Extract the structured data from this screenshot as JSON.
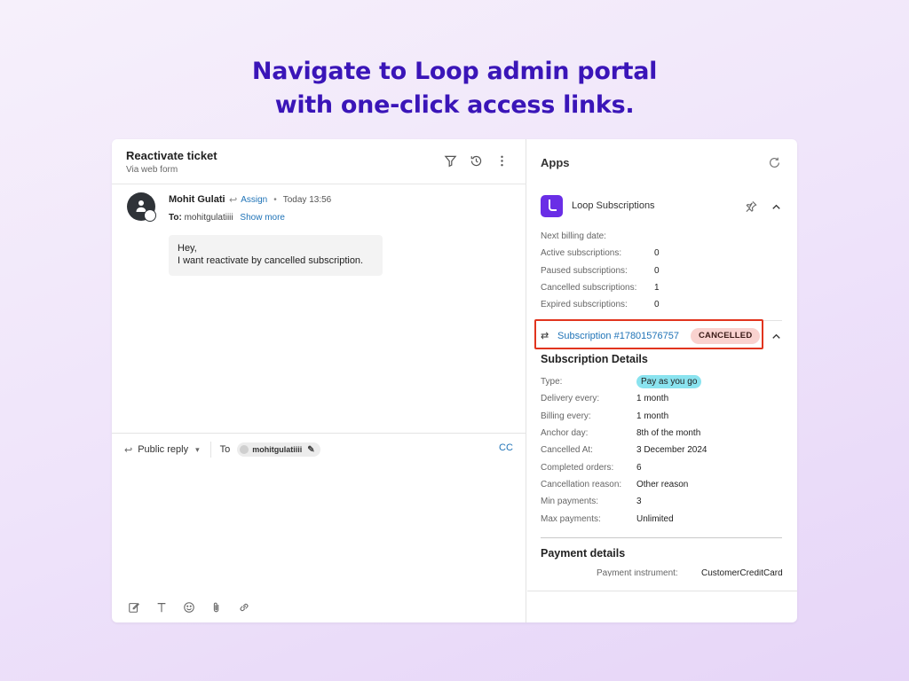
{
  "headline": {
    "line1": "Navigate to Loop admin portal",
    "line2": "with one-click access links."
  },
  "ticket": {
    "title": "Reactivate ticket",
    "subtitle": "Via web form",
    "header_icons": [
      "filter-icon",
      "history-icon",
      "more-vertical-icon"
    ]
  },
  "message": {
    "author": "Mohit Gulati",
    "assign_label": "Assign",
    "time": "Today 13:56",
    "to_label": "To:",
    "to_value": "mohitgulatiiii",
    "show_more": "Show more",
    "body_line1": "Hey,",
    "body_line2": "I want reactivate by cancelled subscription."
  },
  "reply": {
    "mode_label": "Public reply",
    "to_label": "To",
    "recipient_chip": "mohitgulatiiii",
    "cc_label": "CC",
    "toolbar_icons": [
      "compose-icon",
      "text-format-icon",
      "emoji-icon",
      "attachment-icon",
      "link-icon"
    ]
  },
  "apps": {
    "title": "Apps",
    "app_name": "Loop Subscriptions",
    "brand_color": "#6a2ee6",
    "stats": [
      {
        "label": "Next billing date:",
        "value": ""
      },
      {
        "label": "Active subscriptions:",
        "value": "0"
      },
      {
        "label": "Paused subscriptions:",
        "value": "0"
      },
      {
        "label": "Cancelled subscriptions:",
        "value": "1"
      },
      {
        "label": "Expired subscriptions:",
        "value": "0"
      }
    ],
    "subscription_link": "Subscription #17801576757",
    "status_badge": "CANCELLED",
    "status_color": "#f9d2cf",
    "highlight_color": "#e1341e",
    "details_title": "Subscription Details",
    "details": [
      {
        "label": "Type:",
        "value": "Pay as you go"
      },
      {
        "label": "Delivery every:",
        "value": "1 month"
      },
      {
        "label": "Billing every:",
        "value": "1 month"
      },
      {
        "label": "Anchor day:",
        "value": "8th of the month"
      },
      {
        "label": "Cancelled At:",
        "value": "3 December 2024"
      },
      {
        "label": "Completed orders:",
        "value": "6"
      },
      {
        "label": "Cancellation reason:",
        "value": "Other reason"
      },
      {
        "label": "Min payments:",
        "value": "3"
      },
      {
        "label": "Max payments:",
        "value": "Unlimited"
      }
    ],
    "payment_title": "Payment details",
    "payment_row": {
      "label": "Payment instrument:",
      "value": "CustomerCreditCard"
    }
  }
}
